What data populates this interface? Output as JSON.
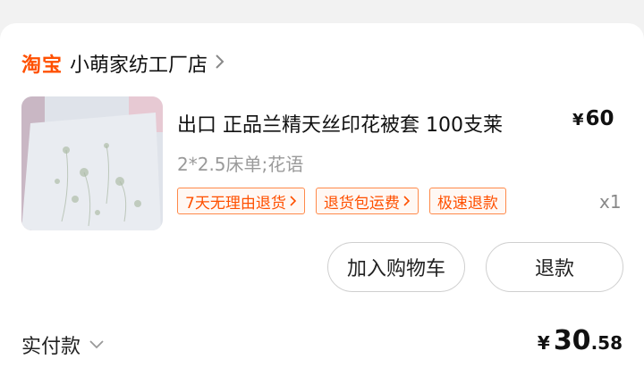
{
  "shop": {
    "brand": "淘宝",
    "name": "小萌家纺工厂店"
  },
  "product": {
    "title": "出口 正品兰精天丝印花被套 100支莱",
    "price_symbol": "¥",
    "price": "60",
    "sku": "2*2.5床单;花语",
    "tags": [
      "7天无理由退货",
      "退货包运费",
      "极速退款"
    ],
    "quantity": "x1",
    "image": "bedding-thumbnail"
  },
  "actions": {
    "add_to_cart": "加入购物车",
    "refund": "退款"
  },
  "payment": {
    "label": "实付款",
    "currency": "¥",
    "amount_int": "30",
    "amount_dec": ".58"
  },
  "colors": {
    "brand": "#ff5000",
    "tag_border": "#ff8a4a",
    "muted": "#9a9a9a"
  },
  "icons": [
    "chevron-right-icon",
    "chevron-down-icon"
  ]
}
